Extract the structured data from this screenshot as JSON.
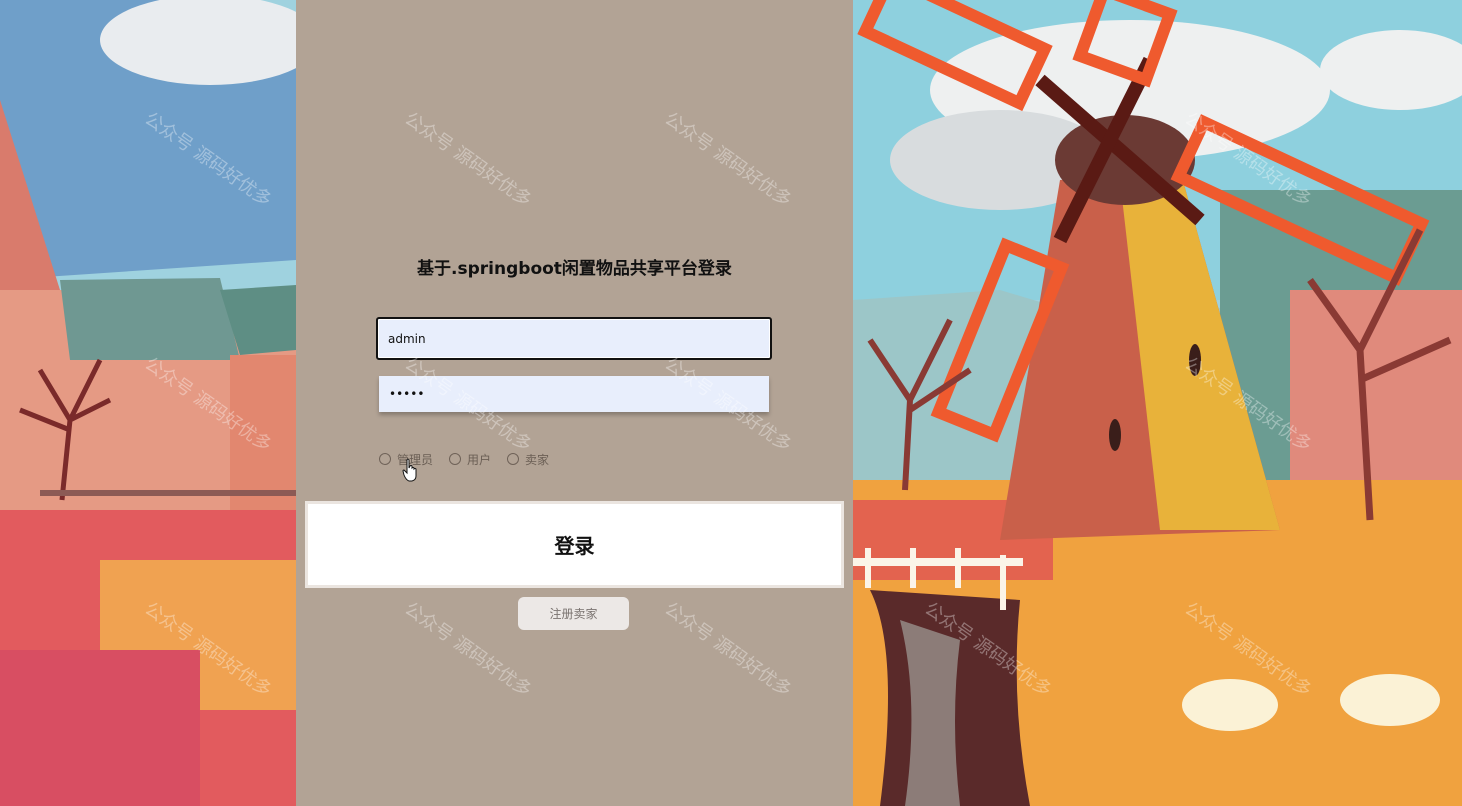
{
  "login": {
    "title": "基于.springboot闲置物品共享平台登录",
    "username_value": "admin",
    "password_value": "•••••",
    "roles": [
      "管理员",
      "用户",
      "卖家"
    ],
    "login_label": "登录",
    "register_label": "注册卖家"
  },
  "watermark": {
    "text": "公众号 源码好优多"
  },
  "colors": {
    "panel": "#b2a395",
    "input_bg": "#e8eefc",
    "windmill_blades": "#ef5a2e"
  },
  "icons": {
    "cursor": "hand-pointer-icon"
  }
}
